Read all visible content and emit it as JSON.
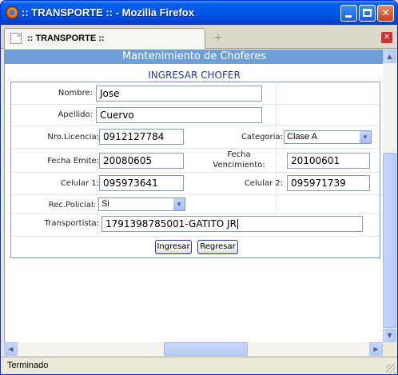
{
  "window": {
    "title": ":: TRANSPORTE :: - Mozilla Firefox",
    "minimize_label": "_",
    "maximize_label": "□",
    "close_label": "✕"
  },
  "tabs": [
    {
      "label": ":: TRANSPORTE ::"
    }
  ],
  "tab_close_label": "✕",
  "new_tab_label": "+",
  "page": {
    "header": "Mantenimiento de Choferes",
    "subtitle": "INGRESAR CHOFER"
  },
  "form": {
    "nombre": {
      "label": "Nombre:",
      "value": "Jose"
    },
    "apellido": {
      "label": "Apellido:",
      "value": "Cuervo"
    },
    "licencia": {
      "label": "Nro.Licencia:",
      "value": "0912127784"
    },
    "categoria": {
      "label": "Categoria:",
      "value": "Clase A"
    },
    "fecha_emite": {
      "label": "Fecha Emite:",
      "value": "20080605"
    },
    "fecha_vencimiento": {
      "label_line1": "Fecha",
      "label_line2": "Vencimiento:",
      "value": "20100601"
    },
    "celular1": {
      "label": "Celular 1:",
      "value": "095973641"
    },
    "celular2": {
      "label": "Celular 2:",
      "value": "095971739"
    },
    "rec_policial": {
      "label": "Rec.Policial:",
      "value": "Si"
    },
    "transportista": {
      "label": "Transportista:",
      "value": "1791398785001-GATITO  JR"
    }
  },
  "buttons": {
    "ingresar": "Ingresar",
    "regresar": "Regresar"
  },
  "scrollbar_arrows": {
    "up": "▲",
    "down": "▼",
    "left": "◀",
    "right": "▶",
    "dropdown": "▼"
  },
  "status": {
    "text": "Terminado"
  }
}
